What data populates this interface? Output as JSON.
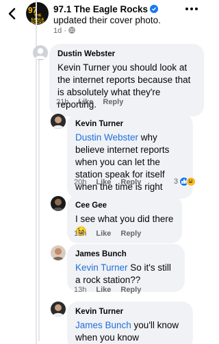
{
  "post": {
    "page_name": "97.1 The Eagle Rocks",
    "action": "updated their cover photo.",
    "time": "1d",
    "logo_text_top": "97",
    "logo_text_bottom": "THE EAGLE ROCKS"
  },
  "comments": [
    {
      "author": "Dustin Webster",
      "mention": "",
      "text": "Kevin Turner you should look at the internet reports because that is absolutely what they're reporting.",
      "time": "21h",
      "like": "Like",
      "reply": "Reply"
    },
    {
      "author": "Kevin Turner",
      "mention": "Dustin Webster",
      "text": " why believe internet reports when you can let the station speak for itself when the time is right",
      "time": "20h",
      "like": "Like",
      "reply": "Reply",
      "reaction_count": "3"
    },
    {
      "author": "Cee Gee",
      "mention": "",
      "text": "I see what you did there😉",
      "time": "19h",
      "like": "Like",
      "reply": "Reply"
    },
    {
      "author": "James Bunch",
      "mention": "Kevin Turner",
      "text": "  So it's still a rock station??",
      "time": "13h",
      "like": "Like",
      "reply": "Reply"
    },
    {
      "author": "Kevin Turner",
      "mention": "James Bunch",
      "text": " you'll know when you know",
      "time": "",
      "like": "",
      "reply": ""
    }
  ],
  "colors": {
    "bubble": "#f0f2f5",
    "mention": "#216fdb",
    "meta": "#65676b",
    "verified": "#1877f2"
  },
  "icons": [
    "back-arrow-icon",
    "verified-badge-icon",
    "more-options-icon",
    "globe-icon",
    "like-reaction-icon",
    "haha-reaction-icon"
  ]
}
